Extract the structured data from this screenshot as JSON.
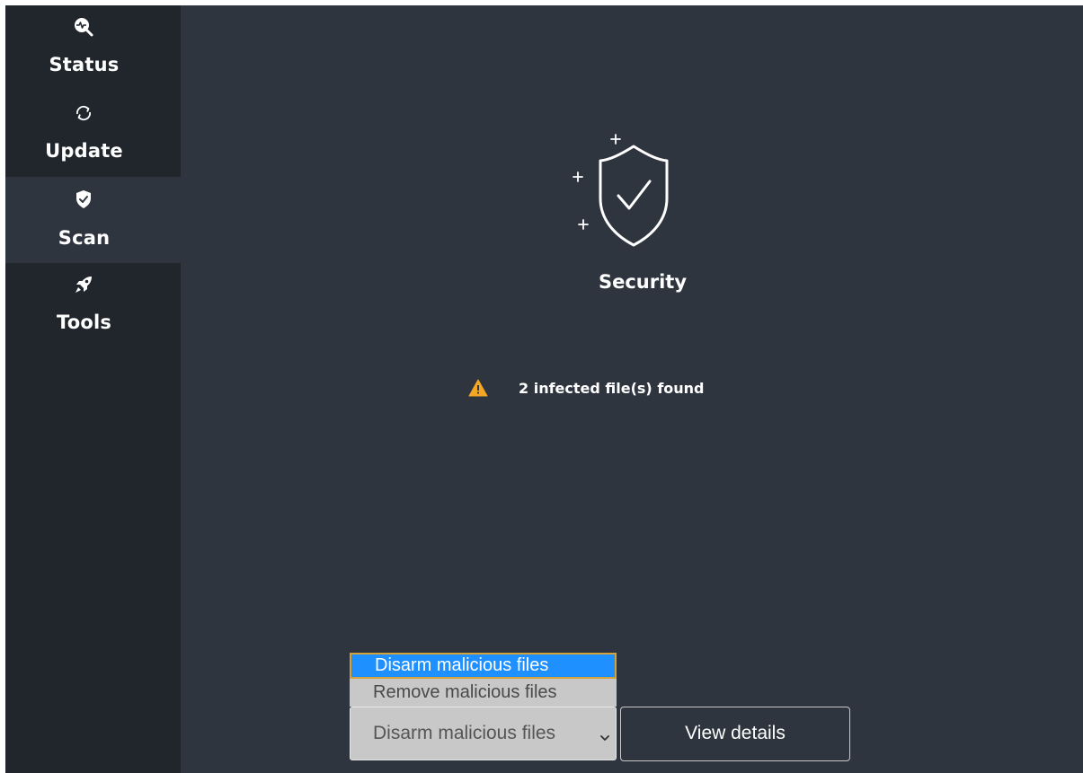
{
  "sidebar": {
    "items": [
      {
        "label": "Status",
        "icon": "status-magnifier-icon",
        "active": false
      },
      {
        "label": "Update",
        "icon": "update-sync-icon",
        "active": false
      },
      {
        "label": "Scan",
        "icon": "shield-check-icon",
        "active": true
      },
      {
        "label": "Tools",
        "icon": "rocket-icon",
        "active": false
      }
    ]
  },
  "main": {
    "title": "Security",
    "hero_icon": "shield-check-outline-icon",
    "status_icon": "warning-triangle-icon",
    "status_message": "2 infected file(s) found"
  },
  "actions": {
    "select_value": "Disarm malicious files",
    "select_options": [
      "Disarm malicious files",
      "Remove malicious files"
    ],
    "details_label": "View details"
  },
  "colors": {
    "sidebar_bg": "#21262c",
    "main_bg": "#2f353f",
    "warning": "#f5a623",
    "option_highlight": "#1e90ff"
  }
}
